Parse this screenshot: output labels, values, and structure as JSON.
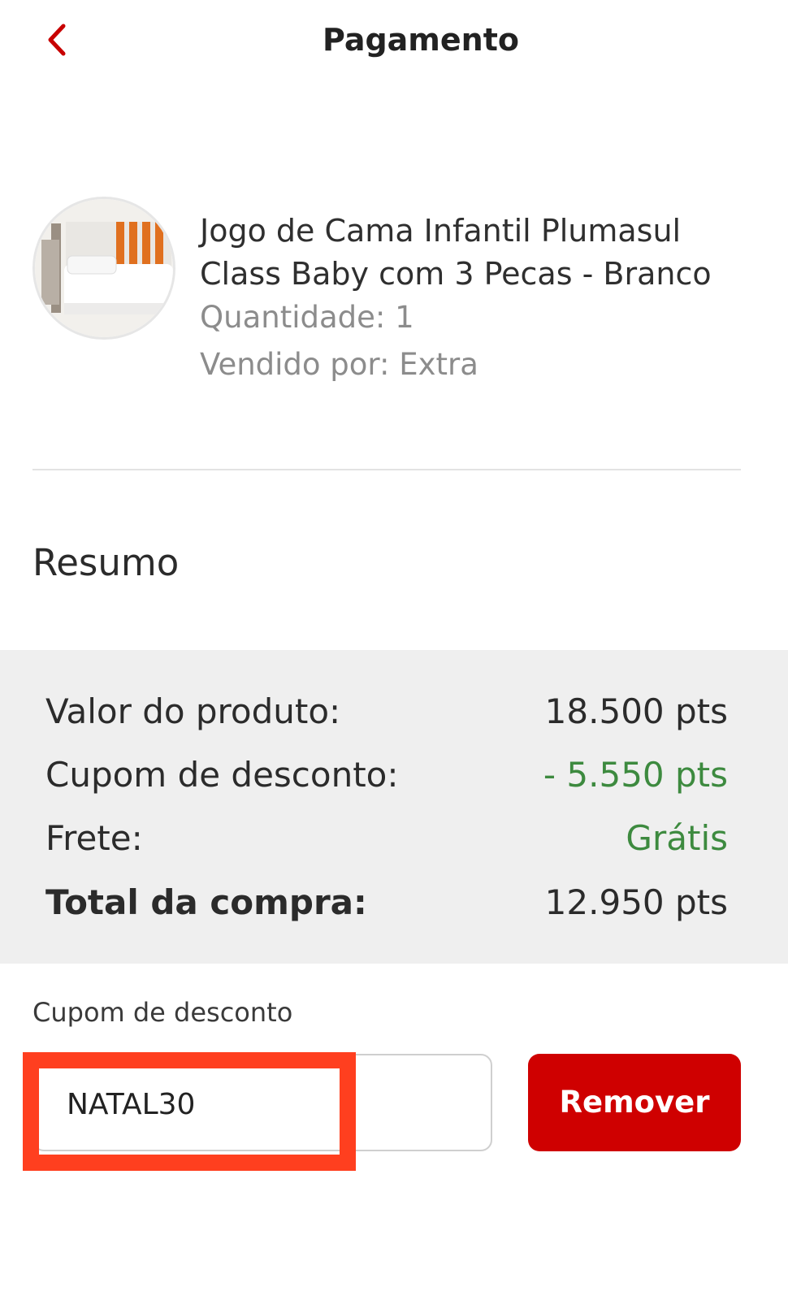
{
  "header": {
    "title": "Pagamento",
    "back_icon": "chevron-left-icon",
    "accent_color": "#c80000"
  },
  "product": {
    "image_icon": "bedding-photo",
    "name": "Jogo de Cama Infantil Plumasul Class Baby com 3 Pecas - Branco",
    "quantity": "Quantidade: 1",
    "seller": "Vendido por: Extra"
  },
  "summary": {
    "title": "Resumo",
    "rows": [
      {
        "label": "Valor do produto:",
        "value": "18.500 pts",
        "color": "#2b2b2b"
      },
      {
        "label": "Cupom de desconto:",
        "value": "- 5.550 pts",
        "color": "#3d8a3f"
      },
      {
        "label": "Frete:",
        "value": "Grátis",
        "color": "#3d8a3f"
      },
      {
        "label": "Total da compra:",
        "value": "12.950 pts",
        "color": "#2b2b2b"
      }
    ]
  },
  "coupon": {
    "label": "Cupom de desconto",
    "value": "NATAL30",
    "remove_label": "Remover",
    "button_color": "#cf0000",
    "highlight_color": "#ff3f1f"
  }
}
